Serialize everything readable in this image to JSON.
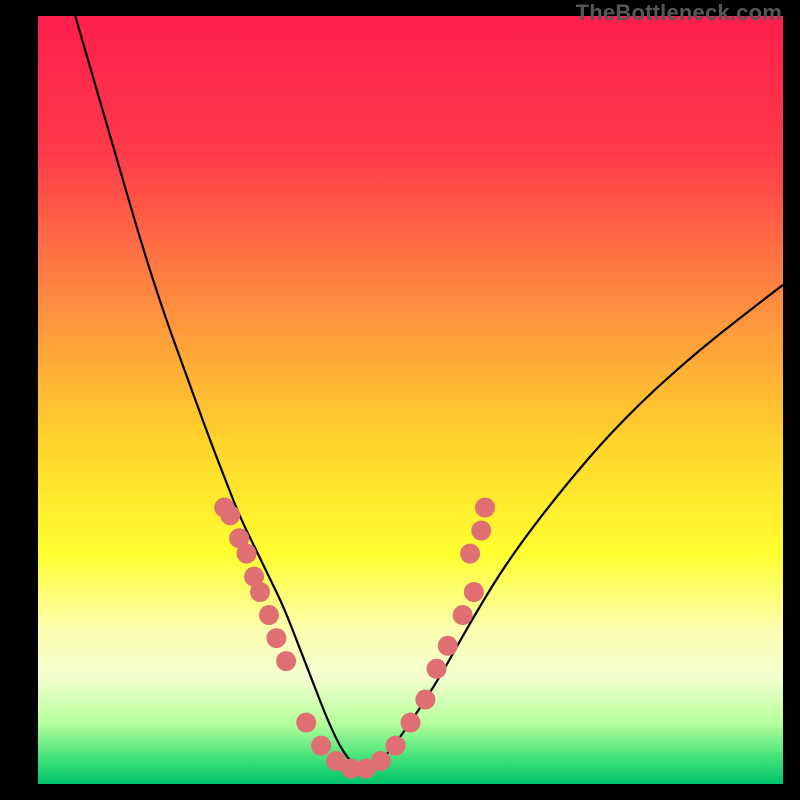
{
  "watermark": "TheBottleneck.com",
  "chart_data": {
    "type": "line",
    "title": "",
    "xlabel": "",
    "ylabel": "",
    "xlim": [
      0,
      100
    ],
    "ylim": [
      0,
      100
    ],
    "grid": false,
    "legend": false,
    "background": {
      "type": "vertical-gradient",
      "stops": [
        {
          "pos": 0.0,
          "color": "#ff1f4c"
        },
        {
          "pos": 0.18,
          "color": "#ff3b4b"
        },
        {
          "pos": 0.38,
          "color": "#ff8f3f"
        },
        {
          "pos": 0.55,
          "color": "#ffd22c"
        },
        {
          "pos": 0.7,
          "color": "#ffff30"
        },
        {
          "pos": 0.8,
          "color": "#fcffb0"
        },
        {
          "pos": 0.86,
          "color": "#f4ffd0"
        },
        {
          "pos": 0.92,
          "color": "#b8ff9c"
        },
        {
          "pos": 0.965,
          "color": "#44e27a"
        },
        {
          "pos": 1.0,
          "color": "#00c46a"
        }
      ]
    },
    "series": [
      {
        "name": "bottleneck-curve",
        "comment": "V-shaped curve; y ~ bottleneck percentage (100=top/red, 0=bottom/green). Minimum near x≈42.",
        "x": [
          5,
          8,
          11,
          14,
          17,
          20,
          23,
          25,
          27,
          29,
          31,
          33,
          35,
          37,
          39,
          41,
          43,
          45,
          47,
          50,
          54,
          58,
          63,
          70,
          78,
          88,
          100
        ],
        "values": [
          100,
          90,
          80,
          70,
          61,
          53,
          45,
          40,
          35,
          31,
          27,
          23,
          18,
          13,
          8,
          4,
          2,
          2,
          4,
          8,
          14,
          21,
          29,
          38,
          47,
          56,
          65
        ]
      },
      {
        "name": "left-cluster-markers",
        "type": "scatter",
        "comment": "Salmon dots clustered on the descending (left) arm, roughly 20%–35% height.",
        "points": [
          {
            "x": 25.0,
            "y": 36
          },
          {
            "x": 25.8,
            "y": 35
          },
          {
            "x": 27.0,
            "y": 32
          },
          {
            "x": 28.0,
            "y": 30
          },
          {
            "x": 29.0,
            "y": 27
          },
          {
            "x": 29.8,
            "y": 25
          },
          {
            "x": 31.0,
            "y": 22
          },
          {
            "x": 32.0,
            "y": 19
          },
          {
            "x": 33.3,
            "y": 16
          }
        ]
      },
      {
        "name": "right-cluster-markers",
        "type": "scatter",
        "comment": "Salmon dots on the ascending (right) arm.",
        "points": [
          {
            "x": 53.5,
            "y": 15
          },
          {
            "x": 55.0,
            "y": 18
          },
          {
            "x": 57.0,
            "y": 22
          },
          {
            "x": 58.5,
            "y": 25
          },
          {
            "x": 58.0,
            "y": 30
          },
          {
            "x": 59.5,
            "y": 33
          },
          {
            "x": 60.0,
            "y": 36
          }
        ]
      },
      {
        "name": "bottom-cluster-markers",
        "type": "scatter",
        "comment": "Salmon dots lining the trough of the curve.",
        "points": [
          {
            "x": 36.0,
            "y": 8
          },
          {
            "x": 38.0,
            "y": 5
          },
          {
            "x": 40.0,
            "y": 3
          },
          {
            "x": 42.0,
            "y": 2
          },
          {
            "x": 44.0,
            "y": 2
          },
          {
            "x": 46.0,
            "y": 3
          },
          {
            "x": 48.0,
            "y": 5
          },
          {
            "x": 50.0,
            "y": 8
          },
          {
            "x": 52.0,
            "y": 11
          }
        ]
      }
    ],
    "marker_style": {
      "color": "#e06f73",
      "radius_px": 10
    }
  }
}
